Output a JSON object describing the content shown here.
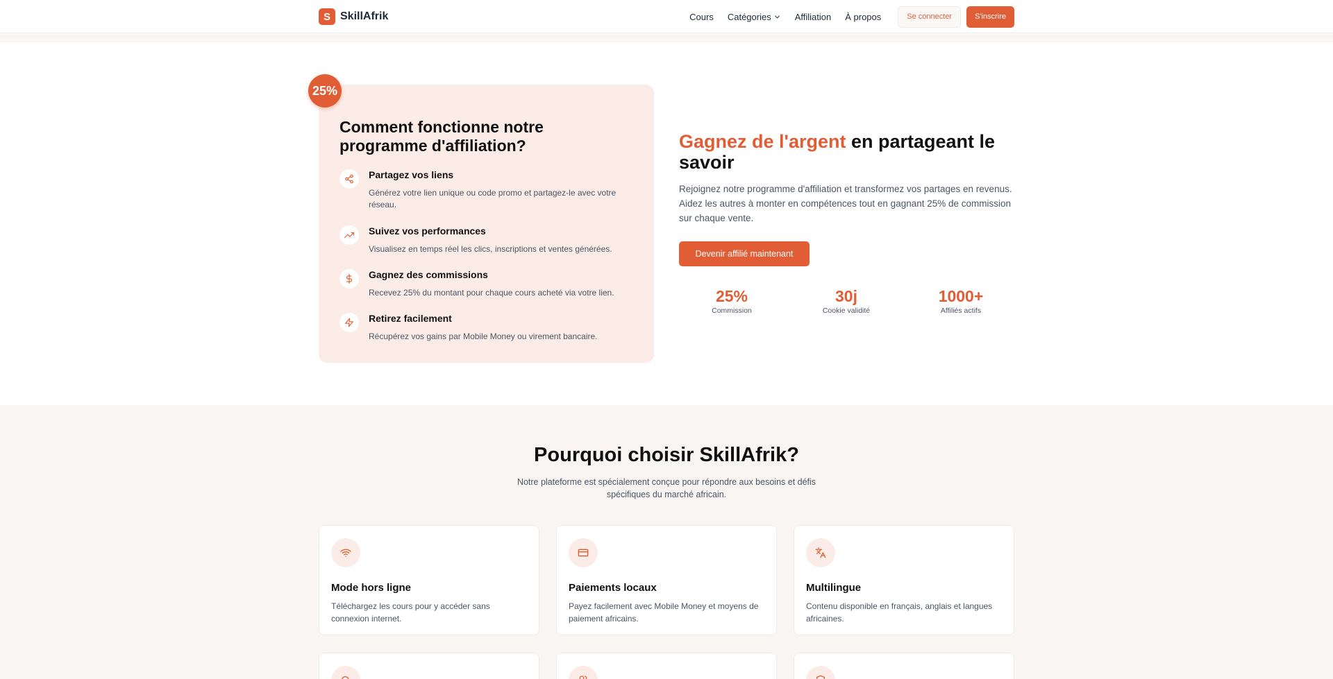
{
  "nav": {
    "logo_letter": "S",
    "brand": "SkillAfrik",
    "links": [
      "Cours",
      "Catégories",
      "Affiliation",
      "À propos"
    ],
    "login": "Se connecter",
    "signup": "S'inscrire"
  },
  "affiliate": {
    "badge": "25%",
    "title": "Comment fonctionne notre programme d'affiliation?",
    "steps": [
      {
        "icon": "share-icon",
        "title": "Partagez vos liens",
        "desc": "Générez votre lien unique ou code promo et partagez-le avec votre réseau."
      },
      {
        "icon": "trending-up-icon",
        "title": "Suivez vos performances",
        "desc": "Visualisez en temps réel les clics, inscriptions et ventes générées."
      },
      {
        "icon": "dollar-icon",
        "title": "Gagnez des commissions",
        "desc": "Recevez 25% du montant pour chaque cours acheté via votre lien."
      },
      {
        "icon": "zap-icon",
        "title": "Retirez facilement",
        "desc": "Récupérez vos gains par Mobile Money ou virement bancaire."
      }
    ]
  },
  "hero": {
    "title_accent": "Gagnez de l'argent",
    "title_rest": " en partageant le savoir",
    "description": "Rejoignez notre programme d'affiliation et transformez vos partages en revenus. Aidez les autres à monter en compétences tout en gagnant 25% de commission sur chaque vente.",
    "cta": "Devenir affilié maintenant",
    "stats": [
      {
        "value": "25%",
        "label": "Commission"
      },
      {
        "value": "30j",
        "label": "Cookie validité"
      },
      {
        "value": "1000+",
        "label": "Affiliés actifs"
      }
    ]
  },
  "why": {
    "title": "Pourquoi choisir SkillAfrik?",
    "subtitle": "Notre plateforme est spécialement conçue pour répondre aux besoins et défis spécifiques du marché africain.",
    "features": [
      {
        "icon": "wifi-icon",
        "title": "Mode hors ligne",
        "desc": "Téléchargez les cours pour y accéder sans connexion internet."
      },
      {
        "icon": "credit-card-icon",
        "title": "Paiements locaux",
        "desc": "Payez facilement avec Mobile Money et moyens de paiement africains."
      },
      {
        "icon": "languages-icon",
        "title": "Multilingue",
        "desc": "Contenu disponible en français, anglais et langues africaines."
      }
    ]
  },
  "colors": {
    "accent": "#e05d35",
    "accent_soft": "#fcece7",
    "section_bg": "#f8f5f3"
  }
}
